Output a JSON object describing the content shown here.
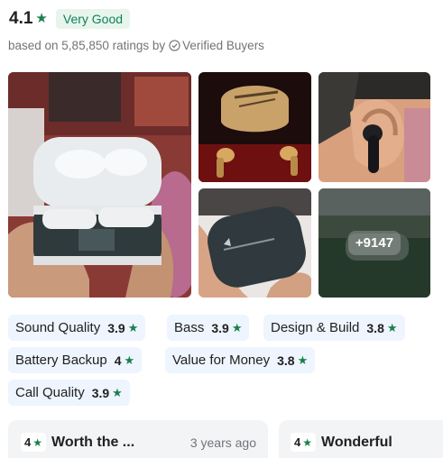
{
  "rating": {
    "value": "4.1",
    "star": "★",
    "label": "Very Good",
    "based_on": "based on 5,85,850 ratings by",
    "verified": "Verified Buyers"
  },
  "photos": {
    "more_count": "+9147"
  },
  "aspects": [
    {
      "label": "Sound Quality",
      "value": "3.9"
    },
    {
      "label": "Bass",
      "value": "3.9"
    },
    {
      "label": "Design & Build",
      "value": "3.8"
    },
    {
      "label": "Battery Backup",
      "value": "4"
    },
    {
      "label": "Value for Money",
      "value": "3.8"
    },
    {
      "label": "Call Quality",
      "value": "3.9"
    }
  ],
  "reviews": [
    {
      "rating": "4",
      "title": "Worth the ...",
      "time": "3 years ago"
    },
    {
      "rating": "4",
      "title": "Wonderful",
      "time": ""
    }
  ],
  "colors": {
    "accent_green": "#1a7f4b",
    "badge_bg": "#e7f5ec",
    "chip_bg": "#eef5fe",
    "card_bg": "#f3f4f6"
  }
}
